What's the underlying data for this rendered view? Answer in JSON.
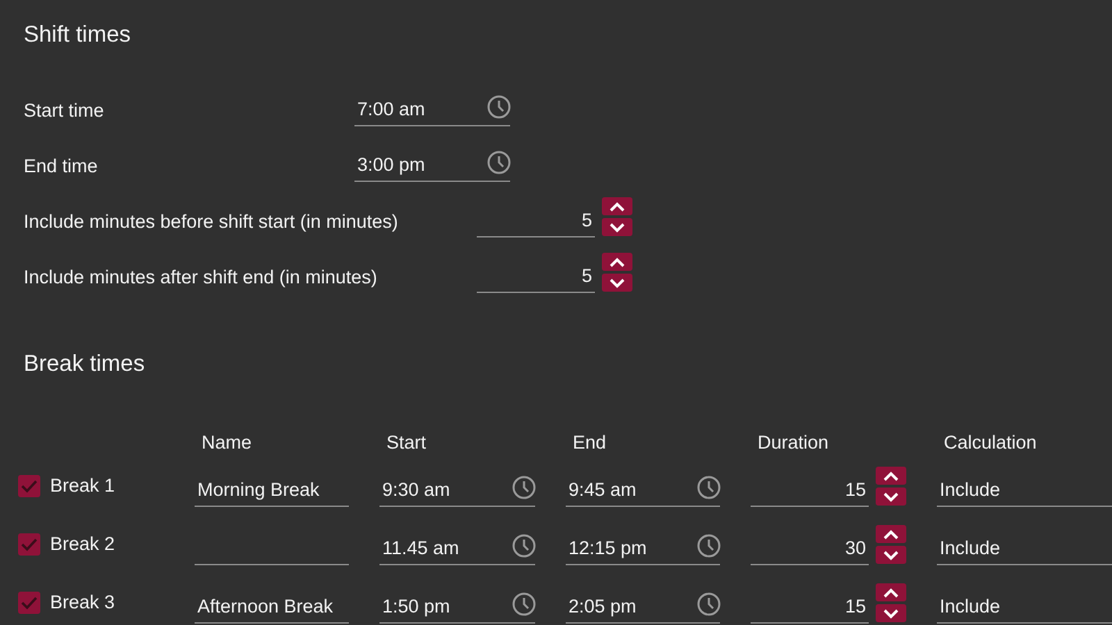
{
  "shift_section": {
    "title": "Shift times",
    "fields": [
      {
        "kind": "time",
        "label": "Start time",
        "value": "7:00 am"
      },
      {
        "kind": "time",
        "label": "End time",
        "value": "3:00 pm"
      },
      {
        "kind": "number",
        "label": "Include minutes before shift start (in minutes)",
        "value": "5"
      },
      {
        "kind": "number",
        "label": "Include minutes after shift end (in minutes)",
        "value": "5"
      }
    ]
  },
  "break_section": {
    "title": "Break times",
    "columns": [
      "Name",
      "Start",
      "End",
      "Duration",
      "Calculation"
    ],
    "rows": [
      {
        "checked": true,
        "label": "Break 1",
        "name": "Morning Break",
        "start": "9:30 am",
        "end": "9:45 am",
        "duration": "15",
        "calculation": "Include"
      },
      {
        "checked": true,
        "label": "Break 2",
        "start": "11.45 am",
        "end": "12:15 pm",
        "duration": "30",
        "calculation": "Include"
      },
      {
        "checked": true,
        "label": "Break 3",
        "name": "Afternoon Break",
        "start": "1:50 pm",
        "end": "2:05 pm",
        "duration": "15",
        "calculation": "Include"
      }
    ]
  }
}
